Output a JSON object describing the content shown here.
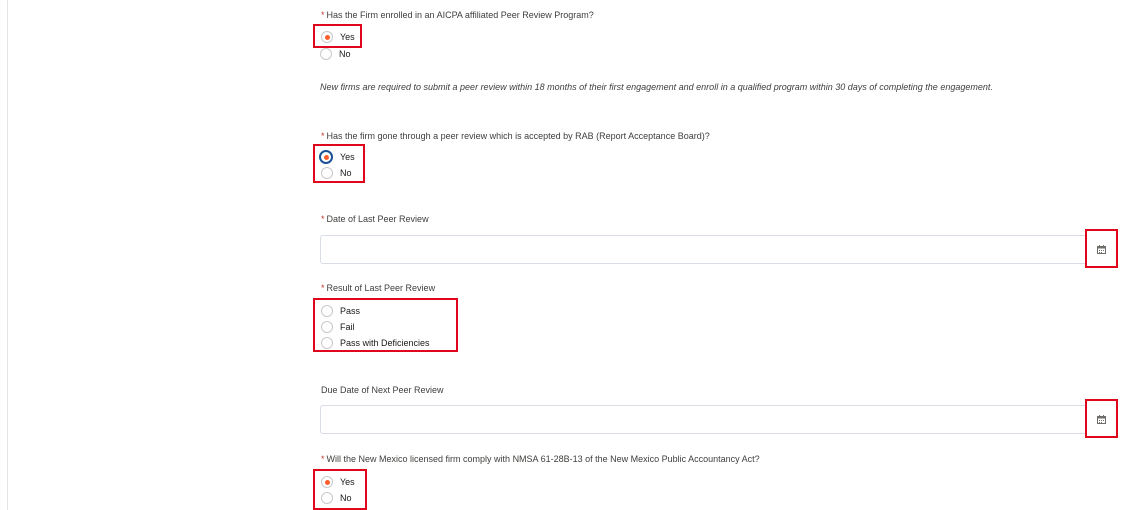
{
  "q1": {
    "required_mark": "*",
    "label": "Has the Firm enrolled in an AICPA affiliated Peer Review Program?",
    "options": [
      "Yes",
      "No"
    ],
    "selected": "Yes"
  },
  "help_text": "New firms are required to submit a peer review within 18 months of their first engagement and enroll in a qualified program within 30 days of completing the engagement.",
  "q2": {
    "required_mark": "*",
    "label": "Has the firm gone through a peer review which is accepted by RAB (Report Acceptance Board)?",
    "options": [
      "Yes",
      "No"
    ],
    "selected": "Yes"
  },
  "date_last_review": {
    "required_mark": "*",
    "label": "Date of Last Peer Review",
    "value": "",
    "icon": "calendar-icon"
  },
  "result_last_review": {
    "required_mark": "*",
    "label": "Result of Last Peer Review",
    "options": [
      "Pass",
      "Fail",
      "Pass with Deficiencies"
    ],
    "selected": ""
  },
  "due_date_next_review": {
    "label": "Due Date of Next Peer Review",
    "value": "",
    "icon": "calendar-icon"
  },
  "q_nm": {
    "required_mark": "*",
    "label": "Will the New Mexico licensed firm comply with NMSA 61-28B-13 of the New Mexico Public Accountancy Act?",
    "options": [
      "Yes",
      "No"
    ],
    "selected": "Yes"
  },
  "colors": {
    "highlight_border": "#e0061c",
    "radio_checked": "#ff5d2d",
    "focus_ring": "#1b5297",
    "required": "#c23934"
  }
}
